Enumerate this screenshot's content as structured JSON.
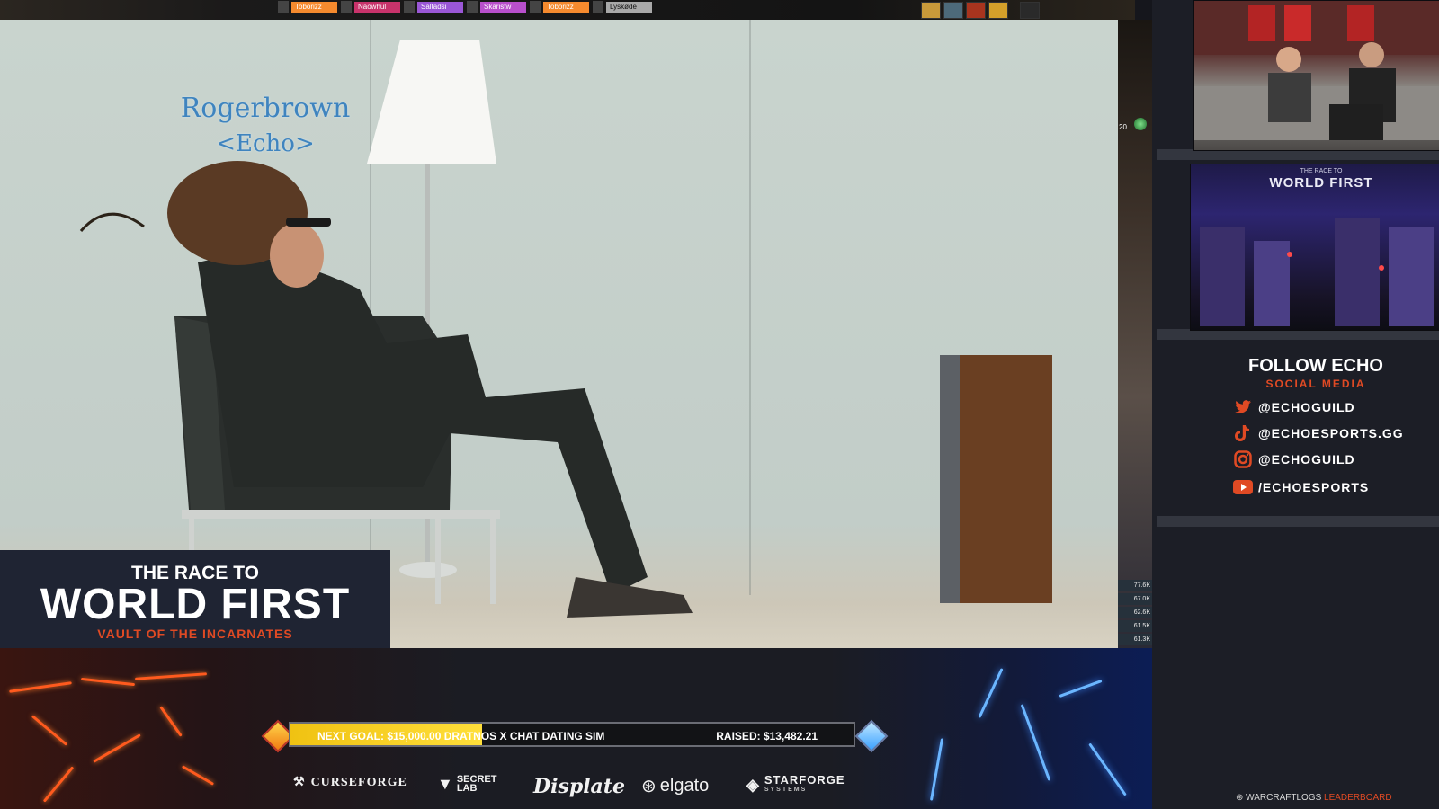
{
  "party_frames": [
    {
      "name": "Toborizz",
      "class_color": "#f58a2e"
    },
    {
      "name": "Naowhul",
      "class_color": "#c8336b"
    },
    {
      "name": "Saltadsi",
      "class_color": "#9a57d6"
    },
    {
      "name": "Skaristw",
      "class_color": "#b84fcc"
    },
    {
      "name": "Toborizz",
      "class_color": "#f58a2e"
    },
    {
      "name": "Lyskøde",
      "class_color": "#a9a9a9"
    }
  ],
  "video": {
    "npc_name": "Rogerbrown",
    "npc_guild": "<Echo>"
  },
  "status": {
    "tag": "20"
  },
  "meters": [
    "77.6K",
    "67.0K",
    "62.6K",
    "61.5K",
    "61.3K"
  ],
  "logo": {
    "line1": "THE RACE TO",
    "line2": "WORLD FIRST",
    "line3": "VAULT OF THE INCARNATES"
  },
  "cam2_overlay": {
    "title": "WORLD FIRST",
    "subtitle": "THE RACE TO"
  },
  "follow": {
    "title": "FOLLOW ECHO",
    "subtitle": "SOCIAL MEDIA",
    "links": [
      {
        "icon": "twitter-icon",
        "handle": "@ECHOGUILD"
      },
      {
        "icon": "tiktok-icon",
        "handle": "@ECHOESPORTS.GG"
      },
      {
        "icon": "instagram-icon",
        "handle": "@ECHOGUILD"
      },
      {
        "icon": "youtube-icon",
        "handle": "/ECHOESPORTS"
      }
    ]
  },
  "goal": {
    "text": "NEXT GOAL: $15,000.00 DRATNOS X CHAT DATING SIM",
    "raised": "RAISED: $13,482.21",
    "progress": 0.34
  },
  "sponsors": [
    "CURSEFORGE",
    "SECRET LAB",
    "Displate",
    "elgato",
    "STARFORGE"
  ],
  "sponsor_sub": "SYSTEMS",
  "footer": {
    "prefix": "WARCRAFTLOGS",
    "suffix": "LEADERBOARD"
  },
  "colors": {
    "accent": "#e04a24",
    "goal_fill": "#f0c212",
    "npc_name": "#3f84bf"
  }
}
